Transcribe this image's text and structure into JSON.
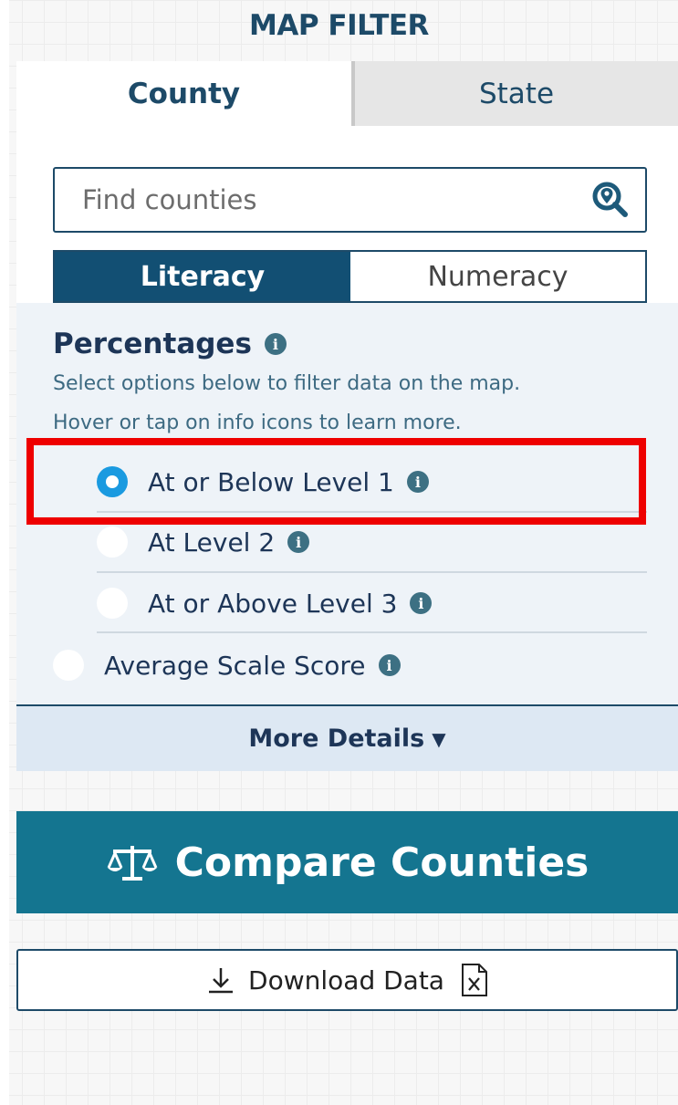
{
  "header": {
    "title": "MAP FILTER"
  },
  "tabs": [
    {
      "label": "County",
      "active": true
    },
    {
      "label": "State",
      "active": false
    }
  ],
  "search": {
    "placeholder": "Find counties",
    "value": "",
    "icon": "search-location-icon"
  },
  "toggle": {
    "options": [
      "Literacy",
      "Numeracy"
    ],
    "selected": "Literacy"
  },
  "section": {
    "title": "Percentages",
    "info_icon": "i",
    "description_line1": "Select options below to filter data on the map.",
    "description_line2": "Hover or tap on info icons to learn more."
  },
  "options": [
    {
      "label": "At or Below Level 1",
      "selected": true
    },
    {
      "label": "At Level 2",
      "selected": false
    },
    {
      "label": "At or Above Level 3",
      "selected": false
    },
    {
      "label": "Average Scale Score",
      "selected": false
    }
  ],
  "more_details": {
    "label": "More Details",
    "caret": "▼"
  },
  "compare_button": {
    "label": "Compare Counties",
    "icon": "balance-scale-icon"
  },
  "download_button": {
    "label": "Download Data",
    "icon": "download-icon",
    "file_icon": "excel-file-icon"
  },
  "colors": {
    "primary": "#124f73",
    "teal": "#147590",
    "selected_radio": "#1a9ae0",
    "highlight": "#ee0000",
    "options_bg": "#eef3f8"
  }
}
